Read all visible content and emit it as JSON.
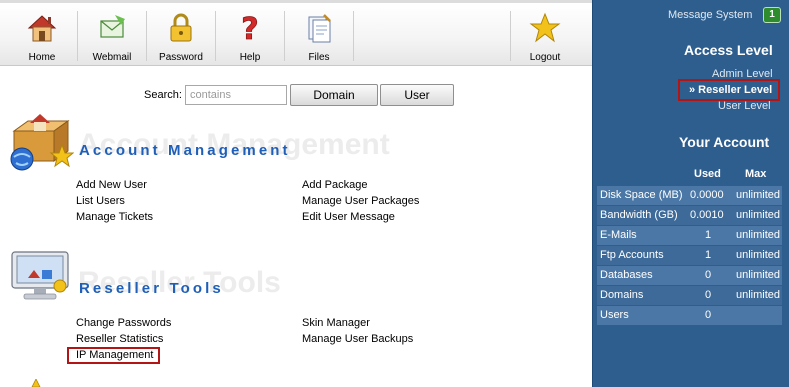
{
  "toolbar": {
    "buttons": [
      {
        "label": "Home",
        "icon": "house-icon"
      },
      {
        "label": "Webmail",
        "icon": "mail-icon"
      },
      {
        "label": "Password",
        "icon": "lock-icon"
      },
      {
        "label": "Help",
        "icon": "question-icon"
      },
      {
        "label": "Files",
        "icon": "files-icon"
      }
    ],
    "logout": {
      "label": "Logout",
      "icon": "star-icon"
    }
  },
  "search": {
    "label": "Search:",
    "placeholder": "contains",
    "domain_button": "Domain",
    "user_button": "User"
  },
  "account_management": {
    "watermark": "Account Management",
    "title": "Account Management",
    "links_left": [
      "Add New User",
      "List Users",
      "Manage Tickets"
    ],
    "links_right": [
      "Add Package",
      "Manage User Packages",
      "Edit User Message"
    ]
  },
  "reseller_tools": {
    "watermark": "Reseller Tools",
    "title": "Reseller Tools",
    "links_left": [
      "Change Passwords",
      "Reseller Statistics",
      "IP Management"
    ],
    "links_right": [
      "Skin Manager",
      "Manage User Backups"
    ]
  },
  "panel": {
    "message_system": "Message System",
    "message_count": "1",
    "access_level_title": "Access Level",
    "levels": [
      "Admin Level",
      "» Reseller Level",
      "User Level"
    ],
    "your_account_title": "Your Account",
    "columns": [
      "Used",
      "Max"
    ],
    "rows": [
      {
        "label": "Disk Space (MB)",
        "used": "0.0000",
        "max": "unlimited"
      },
      {
        "label": "Bandwidth (GB)",
        "used": "0.0010",
        "max": "unlimited"
      },
      {
        "label": "E-Mails",
        "used": "1",
        "max": "unlimited"
      },
      {
        "label": "Ftp Accounts",
        "used": "1",
        "max": "unlimited"
      },
      {
        "label": "Databases",
        "used": "0",
        "max": "unlimited"
      },
      {
        "label": "Domains",
        "used": "0",
        "max": "unlimited"
      },
      {
        "label": "Users",
        "used": "0",
        "max": ""
      }
    ]
  },
  "colors": {
    "panel_bg": "#2e5e8e",
    "row_light": "#4a77a6",
    "row_dark": "#3d6a99",
    "section_title": "#1f5fb8",
    "highlight": "#b31515"
  }
}
